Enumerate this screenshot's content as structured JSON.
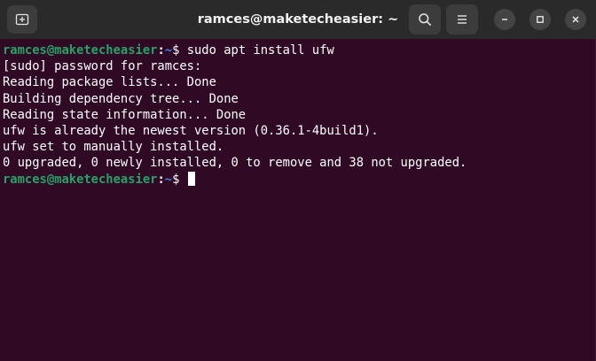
{
  "window": {
    "title": "ramces@maketecheasier: ~"
  },
  "titlebar": {
    "new_tab_icon": "new-tab-icon",
    "search_icon": "search-icon",
    "menu_icon": "hamburger-menu-icon",
    "minimize_icon": "minimize-icon",
    "maximize_icon": "maximize-icon",
    "close_icon": "close-icon"
  },
  "colors": {
    "background": "#300a24",
    "titlebar": "#2a2a2a",
    "prompt_user": "#26a269",
    "prompt_path": "#3584e4",
    "text": "#ffffff"
  },
  "terminal": {
    "prompt": {
      "user_host": "ramces@maketecheasier",
      "colon": ":",
      "path": "~",
      "symbol": "$ "
    },
    "command": "sudo apt install ufw",
    "output": [
      "[sudo] password for ramces:",
      "Reading package lists... Done",
      "Building dependency tree... Done",
      "Reading state information... Done",
      "ufw is already the newest version (0.36.1-4build1).",
      "ufw set to manually installed.",
      "0 upgraded, 0 newly installed, 0 to remove and 38 not upgraded."
    ]
  }
}
